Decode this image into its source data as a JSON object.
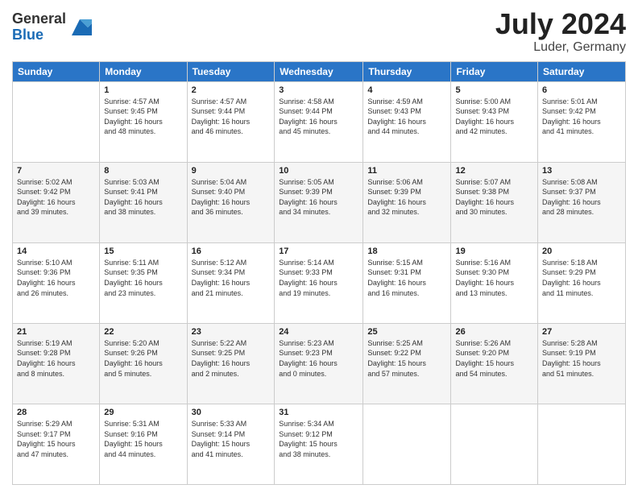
{
  "logo": {
    "general": "General",
    "blue": "Blue"
  },
  "title": {
    "month_year": "July 2024",
    "location": "Luder, Germany"
  },
  "headers": [
    "Sunday",
    "Monday",
    "Tuesday",
    "Wednesday",
    "Thursday",
    "Friday",
    "Saturday"
  ],
  "weeks": [
    [
      {
        "day": "",
        "info": ""
      },
      {
        "day": "1",
        "info": "Sunrise: 4:57 AM\nSunset: 9:45 PM\nDaylight: 16 hours\nand 48 minutes."
      },
      {
        "day": "2",
        "info": "Sunrise: 4:57 AM\nSunset: 9:44 PM\nDaylight: 16 hours\nand 46 minutes."
      },
      {
        "day": "3",
        "info": "Sunrise: 4:58 AM\nSunset: 9:44 PM\nDaylight: 16 hours\nand 45 minutes."
      },
      {
        "day": "4",
        "info": "Sunrise: 4:59 AM\nSunset: 9:43 PM\nDaylight: 16 hours\nand 44 minutes."
      },
      {
        "day": "5",
        "info": "Sunrise: 5:00 AM\nSunset: 9:43 PM\nDaylight: 16 hours\nand 42 minutes."
      },
      {
        "day": "6",
        "info": "Sunrise: 5:01 AM\nSunset: 9:42 PM\nDaylight: 16 hours\nand 41 minutes."
      }
    ],
    [
      {
        "day": "7",
        "info": "Sunrise: 5:02 AM\nSunset: 9:42 PM\nDaylight: 16 hours\nand 39 minutes."
      },
      {
        "day": "8",
        "info": "Sunrise: 5:03 AM\nSunset: 9:41 PM\nDaylight: 16 hours\nand 38 minutes."
      },
      {
        "day": "9",
        "info": "Sunrise: 5:04 AM\nSunset: 9:40 PM\nDaylight: 16 hours\nand 36 minutes."
      },
      {
        "day": "10",
        "info": "Sunrise: 5:05 AM\nSunset: 9:39 PM\nDaylight: 16 hours\nand 34 minutes."
      },
      {
        "day": "11",
        "info": "Sunrise: 5:06 AM\nSunset: 9:39 PM\nDaylight: 16 hours\nand 32 minutes."
      },
      {
        "day": "12",
        "info": "Sunrise: 5:07 AM\nSunset: 9:38 PM\nDaylight: 16 hours\nand 30 minutes."
      },
      {
        "day": "13",
        "info": "Sunrise: 5:08 AM\nSunset: 9:37 PM\nDaylight: 16 hours\nand 28 minutes."
      }
    ],
    [
      {
        "day": "14",
        "info": "Sunrise: 5:10 AM\nSunset: 9:36 PM\nDaylight: 16 hours\nand 26 minutes."
      },
      {
        "day": "15",
        "info": "Sunrise: 5:11 AM\nSunset: 9:35 PM\nDaylight: 16 hours\nand 23 minutes."
      },
      {
        "day": "16",
        "info": "Sunrise: 5:12 AM\nSunset: 9:34 PM\nDaylight: 16 hours\nand 21 minutes."
      },
      {
        "day": "17",
        "info": "Sunrise: 5:14 AM\nSunset: 9:33 PM\nDaylight: 16 hours\nand 19 minutes."
      },
      {
        "day": "18",
        "info": "Sunrise: 5:15 AM\nSunset: 9:31 PM\nDaylight: 16 hours\nand 16 minutes."
      },
      {
        "day": "19",
        "info": "Sunrise: 5:16 AM\nSunset: 9:30 PM\nDaylight: 16 hours\nand 13 minutes."
      },
      {
        "day": "20",
        "info": "Sunrise: 5:18 AM\nSunset: 9:29 PM\nDaylight: 16 hours\nand 11 minutes."
      }
    ],
    [
      {
        "day": "21",
        "info": "Sunrise: 5:19 AM\nSunset: 9:28 PM\nDaylight: 16 hours\nand 8 minutes."
      },
      {
        "day": "22",
        "info": "Sunrise: 5:20 AM\nSunset: 9:26 PM\nDaylight: 16 hours\nand 5 minutes."
      },
      {
        "day": "23",
        "info": "Sunrise: 5:22 AM\nSunset: 9:25 PM\nDaylight: 16 hours\nand 2 minutes."
      },
      {
        "day": "24",
        "info": "Sunrise: 5:23 AM\nSunset: 9:23 PM\nDaylight: 16 hours\nand 0 minutes."
      },
      {
        "day": "25",
        "info": "Sunrise: 5:25 AM\nSunset: 9:22 PM\nDaylight: 15 hours\nand 57 minutes."
      },
      {
        "day": "26",
        "info": "Sunrise: 5:26 AM\nSunset: 9:20 PM\nDaylight: 15 hours\nand 54 minutes."
      },
      {
        "day": "27",
        "info": "Sunrise: 5:28 AM\nSunset: 9:19 PM\nDaylight: 15 hours\nand 51 minutes."
      }
    ],
    [
      {
        "day": "28",
        "info": "Sunrise: 5:29 AM\nSunset: 9:17 PM\nDaylight: 15 hours\nand 47 minutes."
      },
      {
        "day": "29",
        "info": "Sunrise: 5:31 AM\nSunset: 9:16 PM\nDaylight: 15 hours\nand 44 minutes."
      },
      {
        "day": "30",
        "info": "Sunrise: 5:33 AM\nSunset: 9:14 PM\nDaylight: 15 hours\nand 41 minutes."
      },
      {
        "day": "31",
        "info": "Sunrise: 5:34 AM\nSunset: 9:12 PM\nDaylight: 15 hours\nand 38 minutes."
      },
      {
        "day": "",
        "info": ""
      },
      {
        "day": "",
        "info": ""
      },
      {
        "day": "",
        "info": ""
      }
    ]
  ]
}
